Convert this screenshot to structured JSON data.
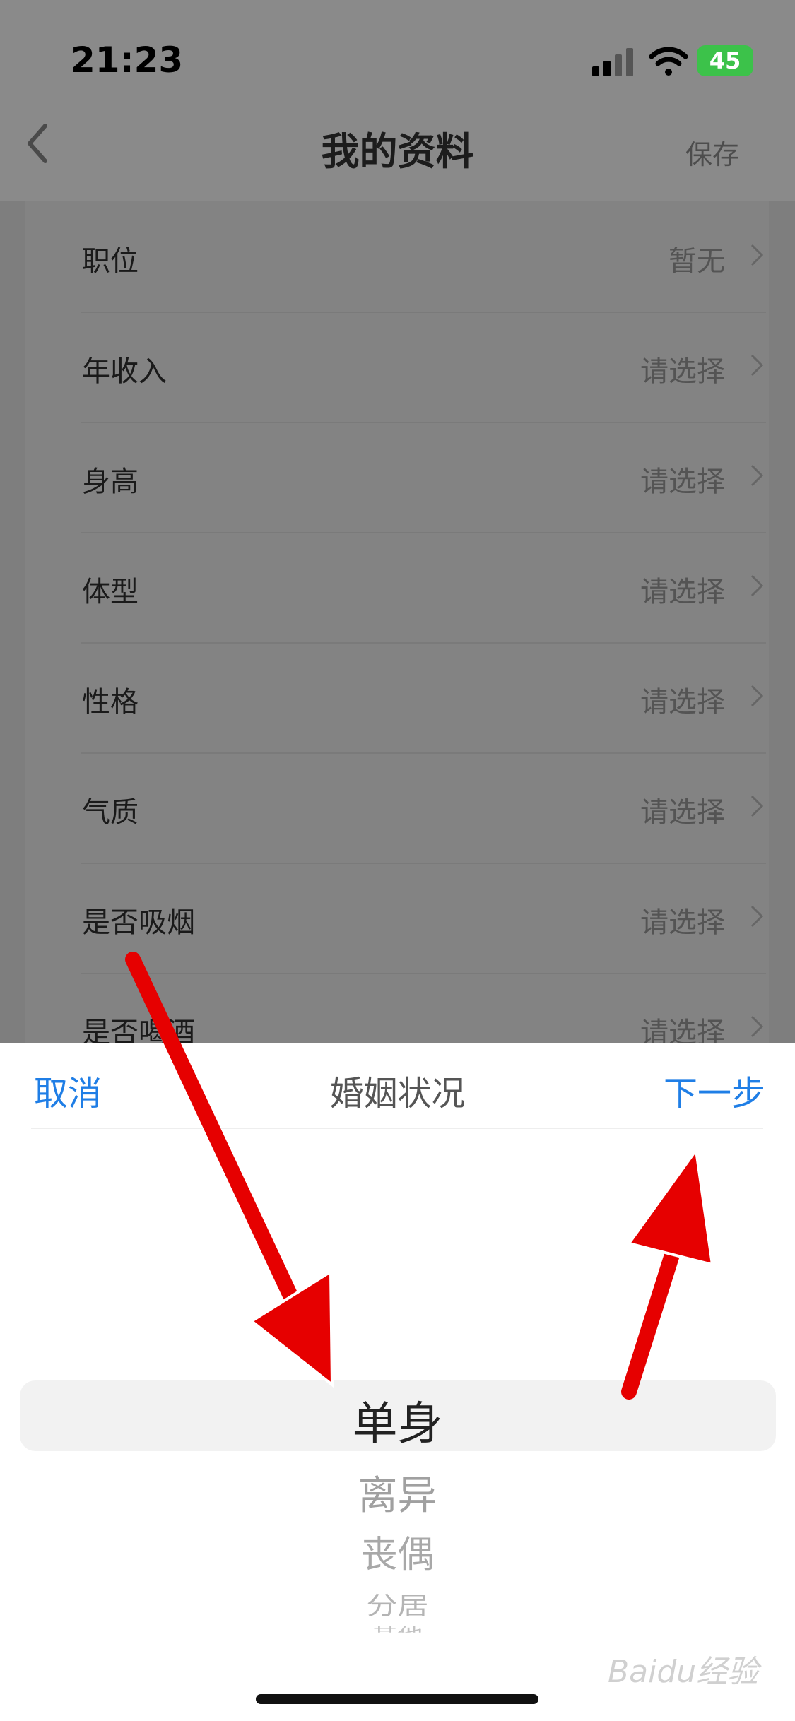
{
  "status_bar": {
    "time": "21:23",
    "battery": "45"
  },
  "nav": {
    "title": "我的资料",
    "save_label": "保存"
  },
  "list": [
    {
      "label": "职位",
      "value": "暂无"
    },
    {
      "label": "年收入",
      "value": "请选择"
    },
    {
      "label": "身高",
      "value": "请选择"
    },
    {
      "label": "体型",
      "value": "请选择"
    },
    {
      "label": "性格",
      "value": "请选择"
    },
    {
      "label": "气质",
      "value": "请选择"
    },
    {
      "label": "是否吸烟",
      "value": "请选择"
    },
    {
      "label": "是否喝酒",
      "value": "请选择"
    }
  ],
  "picker": {
    "cancel_label": "取消",
    "title": "婚姻状况",
    "next_label": "下一步",
    "options": [
      "单身",
      "离异",
      "丧偶",
      "分居",
      "其他"
    ],
    "selected": "单身"
  },
  "watermark": "Baidu经验",
  "colors": {
    "accent": "#1f7ee6",
    "annotation_arrow": "#e60000"
  }
}
